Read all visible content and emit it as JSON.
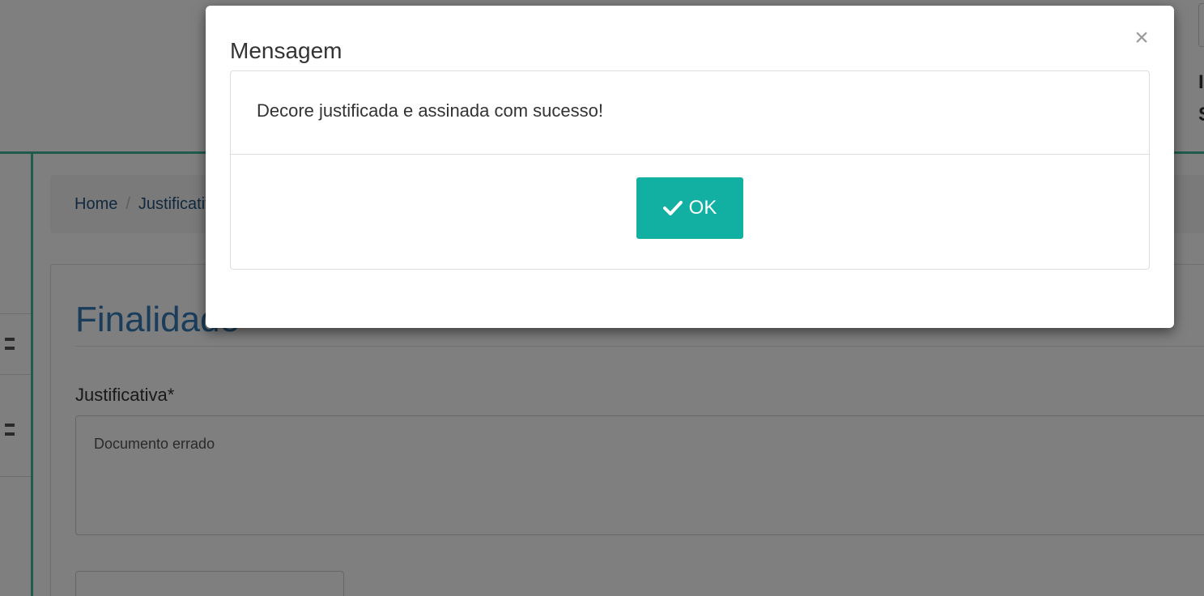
{
  "header": {
    "right_text": "I S"
  },
  "breadcrumb": {
    "home": "Home",
    "separator": "/",
    "current": "Justificativa"
  },
  "form": {
    "title": "Finalidade",
    "justification_label": "Justificativa*",
    "justification_value": "Documento errado"
  },
  "modal": {
    "title": "Mensagem",
    "close_glyph": "×",
    "message": "Decore justificada e assinada com sucesso!",
    "ok_label": "OK",
    "ok_icon": "check-icon"
  },
  "colors": {
    "accent": "#12b0a2",
    "brand_line": "#3fb89a",
    "link": "#337ab7"
  }
}
